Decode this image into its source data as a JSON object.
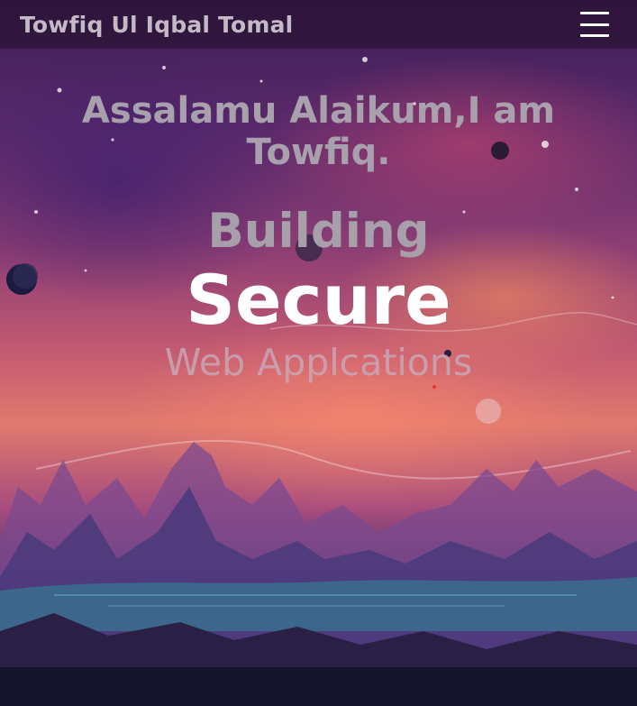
{
  "navbar": {
    "brand": "Towfiq Ul Iqbal Tomal",
    "menu_icon": "hamburger-menu-icon"
  },
  "hero": {
    "greeting": "Assalamu Alaikum,I am Towfiq.",
    "line1": "Building",
    "line2": "Secure",
    "line3": "Web Applcations"
  },
  "colors": {
    "navbar_bg": "#2d1437",
    "brand_text": "#c3bac6",
    "greeting_text": "#a8a0ad",
    "highlight_text": "#ffffff"
  }
}
